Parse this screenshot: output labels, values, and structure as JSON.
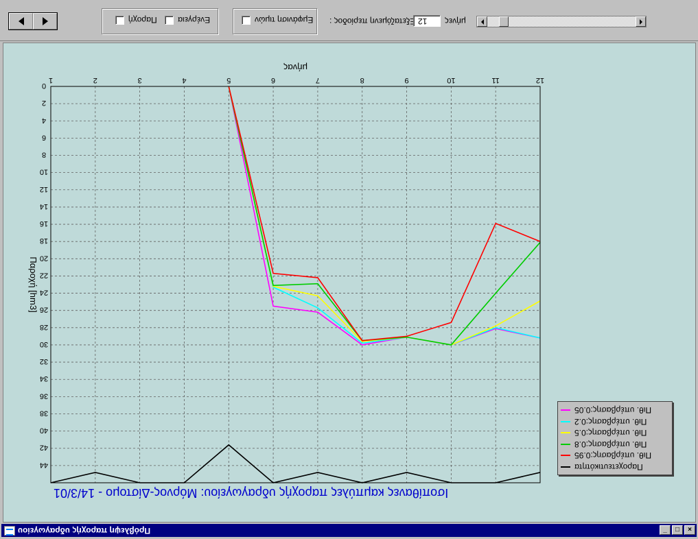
{
  "window": {
    "title": "Πρόβλεψη παροχής υδραγωγείου",
    "minimize": "_",
    "maximize": "□",
    "close": "×"
  },
  "toolbar": {
    "prev_label": "◄",
    "next_label": "►",
    "check_paroxi": "Παροχή",
    "check_energeia": "Ενέργεια",
    "check_tyxon": "Εμφάνιση τιμών",
    "period_label": "Εξεταζόμενη περίοδος :",
    "period_value": "12",
    "period_unit": "μήνες"
  },
  "chart_data": {
    "type": "line",
    "title": "Ισοπίθανες καμπύλες παροχής υδραγωγείου: Μόρνος-Δίστομο - 14/3/01",
    "xlabel": "μήνας",
    "ylabel": "Παροχή [hm3]",
    "x": [
      1,
      2,
      3,
      4,
      5,
      6,
      7,
      8,
      9,
      10,
      11,
      12
    ],
    "xlim": [
      1,
      12
    ],
    "ylim": [
      0,
      46
    ],
    "yticks": [
      0,
      2,
      4,
      6,
      8,
      10,
      12,
      14,
      16,
      18,
      20,
      22,
      24,
      26,
      28,
      30,
      32,
      34,
      36,
      38,
      40,
      42,
      44
    ],
    "y_axis_inverted": true,
    "grid": true,
    "legend_position": "bottom-right",
    "series": [
      {
        "name": "Πιθ. υπέρβασης:0.05",
        "color": "#ff00ff",
        "x": [
          5,
          6,
          7,
          8,
          9,
          10,
          11,
          12
        ],
        "values": [
          0,
          25.5,
          26.2,
          30,
          29.1,
          30,
          28.1,
          29.2
        ]
      },
      {
        "name": "Πιθ. υπέρβασης:0.2",
        "color": "#00ffff",
        "x": [
          5,
          6,
          7,
          8,
          9,
          10,
          11,
          12
        ],
        "values": [
          0,
          23.3,
          25.7,
          29.8,
          29.1,
          30,
          28,
          29.2
        ]
      },
      {
        "name": "Πιθ. υπέρβασης:0.5",
        "color": "#ffff00",
        "x": [
          5,
          6,
          7,
          8,
          9,
          10,
          11,
          12
        ],
        "values": [
          0,
          23.2,
          24.3,
          29.6,
          29.1,
          30,
          27.8,
          24.9
        ]
      },
      {
        "name": "Πιθ. υπέρβασης:0.8",
        "color": "#00cc00",
        "x": [
          5,
          6,
          7,
          8,
          9,
          10,
          11,
          12
        ],
        "values": [
          0,
          23.1,
          22.9,
          29.5,
          29.1,
          30,
          24,
          18.1
        ]
      },
      {
        "name": "Πιθ. υπέρβασης:0.95",
        "color": "#ff0000",
        "x": [
          5,
          6,
          7,
          8,
          9,
          10,
          11,
          12
        ],
        "values": [
          0,
          21.7,
          22.2,
          29.5,
          29,
          27.4,
          15.9,
          18
        ]
      },
      {
        "name": "Παροχετευτικότητα",
        "color": "#000000",
        "x": [
          1,
          2,
          3,
          4,
          5,
          6,
          7,
          8,
          9,
          10,
          11,
          12
        ],
        "values": [
          46,
          44.8,
          46,
          46,
          41.6,
          46,
          44.8,
          46,
          44.8,
          46,
          46,
          44.8
        ]
      }
    ]
  }
}
